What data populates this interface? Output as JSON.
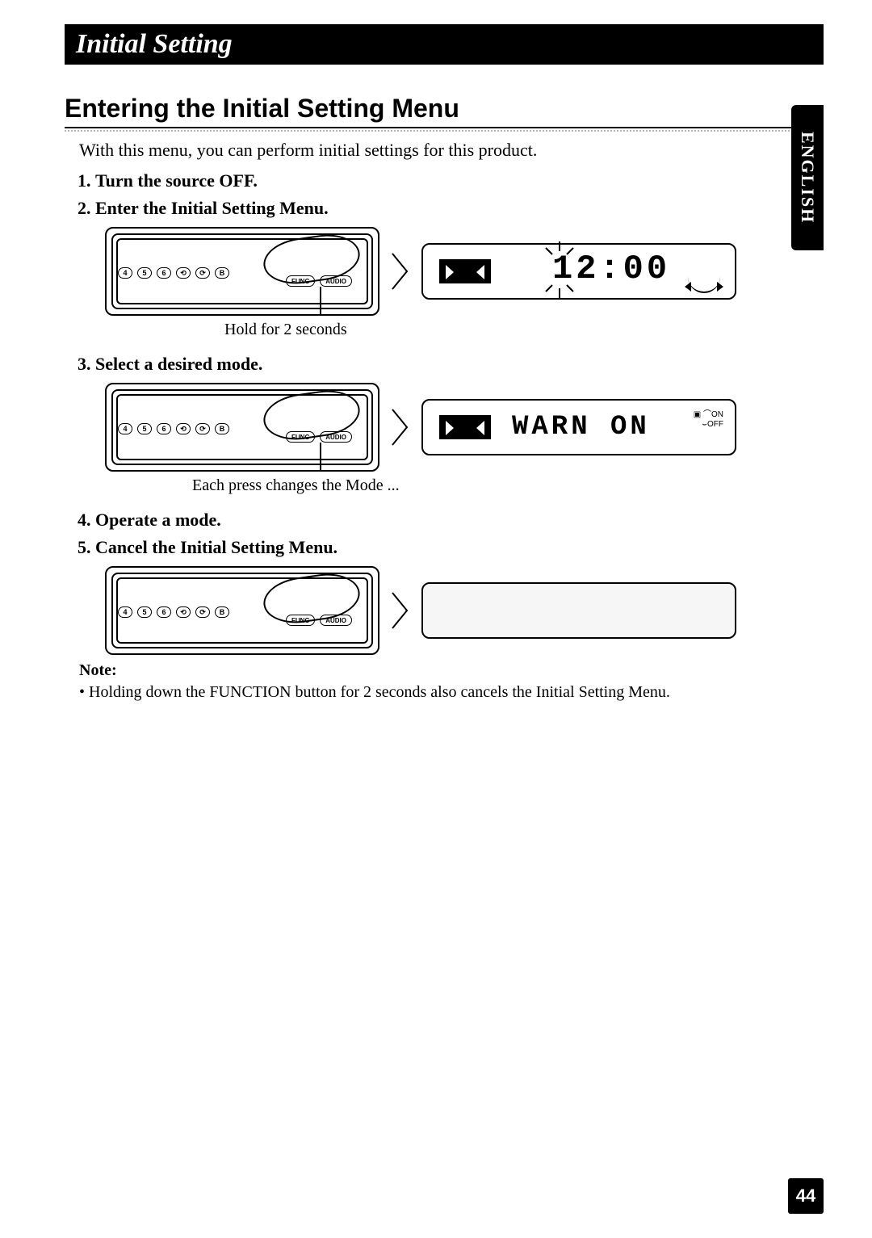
{
  "header": {
    "title": "Initial Setting"
  },
  "sidebar": {
    "language": "ENGLISH"
  },
  "section": {
    "heading": "Entering the Initial Setting Menu",
    "intro": "With this menu, you can perform initial settings for this product."
  },
  "steps": [
    {
      "label": "Turn the source OFF."
    },
    {
      "label": "Enter the Initial Setting Menu.",
      "caption": "Hold for 2 seconds",
      "display_main": "12:00"
    },
    {
      "label": "Select a desired mode.",
      "caption": "Each press changes the Mode ...",
      "display_main": "WARN  ON",
      "indicator_on": "ON",
      "indicator_off": "OFF"
    },
    {
      "label": "Operate a mode."
    },
    {
      "label": "Cancel the Initial Setting Menu."
    }
  ],
  "device": {
    "preset_buttons": [
      "4",
      "5",
      "6"
    ],
    "func_label": "FUNC",
    "audio_label": "AUDIO",
    "b_label": "B"
  },
  "note": {
    "head": "Note:",
    "body": "• Holding down the FUNCTION button for 2 seconds also cancels the Initial Setting Menu."
  },
  "page_number": "44"
}
